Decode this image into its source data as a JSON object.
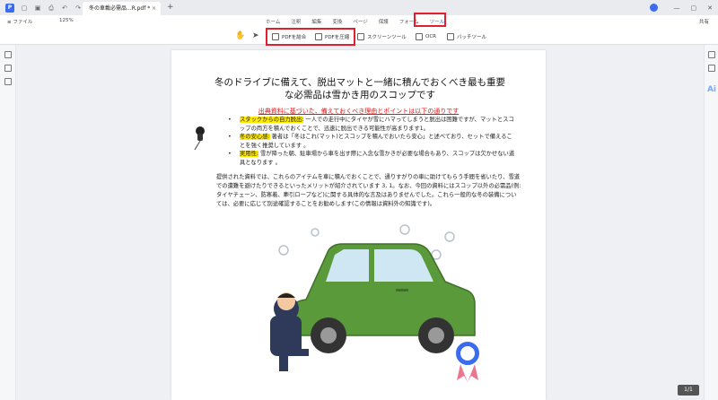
{
  "titlebar": {
    "tab_title": "冬の車載必需品...R.pdf *",
    "close": "×",
    "new_tab": "+"
  },
  "menubar": {
    "file": "≡ ファイル",
    "zoom": "125%",
    "tabs": [
      "ホーム",
      "注釈",
      "編集",
      "変換",
      "ページ",
      "保護",
      "フォーム"
    ],
    "active_tab": "ツール",
    "share": "共有"
  },
  "toolbar": {
    "combine": "PDFを結合",
    "compress": "PDFを圧縮",
    "screen": "スクリーンツール",
    "ocr": "OCR",
    "batch": "バッチツール"
  },
  "document": {
    "title_line1": "冬のドライブに備えて、脱出マットと一緒に積んでおくべき最も重要",
    "title_line2": "な必需品は雪かき用のスコップです",
    "subtitle": "出典資料に基づいた、備えておくべき理由とポイントは以下の通りです",
    "bullets": [
      {
        "label": "スタックからの自力脱出:",
        "text": " 一人での走行中にタイヤが雪にハマってしまうと脱出は困難ですが、マットとスコップの両方を積んでおくことで、迅速に脱出できる可能性が高まります1。"
      },
      {
        "label": "冬の安心感:",
        "text": " 著者は「冬はこれ(マット)とスコップを積んでおいたら安心」と述べており、セットで備えることを強く推奨しています 。"
      },
      {
        "label": "実用性:",
        "text": " 雪が降った朝、駐車場から車を出す際に入念な雪かきが必要な場合もあり、スコップは欠かせない道具となります 。"
      }
    ],
    "paragraph": "提供された資料では、これらのアイテムを車に積んでおくことで、通りすがりの車に助けてもらう手間を省いたり、雪道での遭難を避けたりできるといったメリットが紹介されています 3, 1。なお、今回の資料にはスコップ以外の必需品(例: タイヤチェーン、防寒着、牽引ロープなど)に関する具体的な言及はありませんでした。これら一般的な冬の装備については、必要に応じて別途確認することをお勧めします(この情報は資料外の知識です)。"
  },
  "status": {
    "page": "1/1"
  },
  "colors": {
    "highlight_box": "#e0202e",
    "accent": "#3b6cf0",
    "car": "#5a9a3a"
  }
}
